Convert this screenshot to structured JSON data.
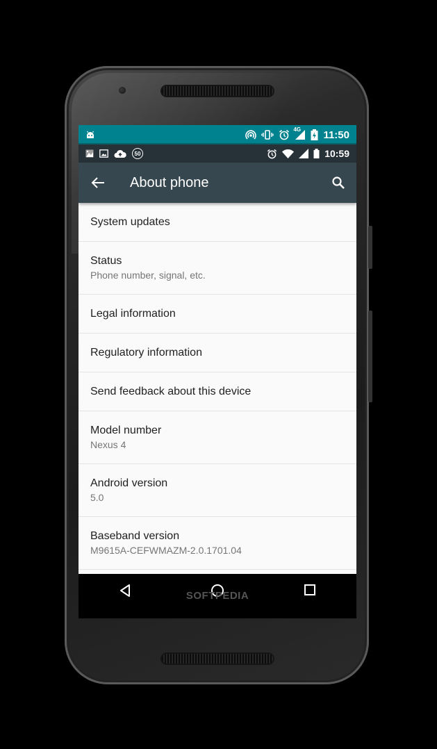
{
  "outer_status": {
    "time": "11:50",
    "network": "4G"
  },
  "inner_status": {
    "time": "10:59",
    "badge": "50"
  },
  "app_bar": {
    "title": "About phone"
  },
  "items": [
    {
      "title": "System updates",
      "subtitle": ""
    },
    {
      "title": "Status",
      "subtitle": "Phone number, signal, etc."
    },
    {
      "title": "Legal information",
      "subtitle": ""
    },
    {
      "title": "Regulatory information",
      "subtitle": ""
    },
    {
      "title": "Send feedback about this device",
      "subtitle": ""
    },
    {
      "title": "Model number",
      "subtitle": "Nexus 4"
    },
    {
      "title": "Android version",
      "subtitle": "5.0"
    },
    {
      "title": "Baseband version",
      "subtitle": "M9615A-CEFWMAZM-2.0.1701.04"
    }
  ],
  "watermark": "SOFTPEDIA",
  "icons": {
    "outer_left": "android-icon",
    "outer_right": [
      "hotspot-icon",
      "vibrate-icon",
      "alarm-icon",
      "signal-icon",
      "battery-charging-icon"
    ],
    "inner_left": [
      "photo-icon",
      "image-icon",
      "cloud-upload-icon",
      "badge-50-icon"
    ],
    "inner_right": [
      "alarm-icon",
      "wifi-icon",
      "signal-icon",
      "battery-icon"
    ],
    "nav": [
      "back-icon",
      "home-icon",
      "recents-icon"
    ]
  },
  "colors": {
    "outer_status_bg": "#00838f",
    "inner_status_bg": "#263238",
    "app_bar_bg": "#37474f"
  }
}
